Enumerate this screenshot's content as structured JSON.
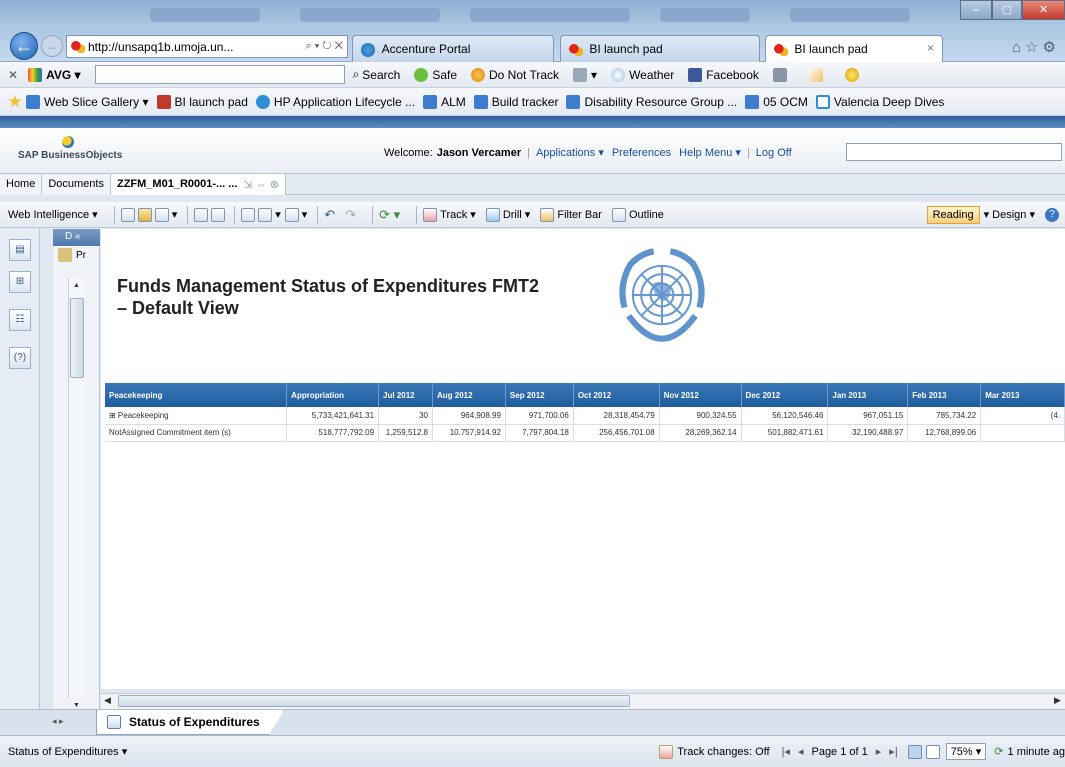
{
  "browser": {
    "address": "http://unsapq1b.umoja.un...",
    "address_controls": "⌕ ▾ ↻ ✕",
    "tabs": [
      "Accenture Portal",
      "BI launch pad",
      "BI launch pad"
    ],
    "tab_close": "×",
    "window_buttons": [
      "–",
      "▢",
      "✕"
    ]
  },
  "avg_toolbar": {
    "close": "✕",
    "brand": "AVG ▾",
    "search": "Search",
    "safe": "Safe",
    "do_not_track": "Do Not Track",
    "weather": "Weather",
    "facebook": "Facebook"
  },
  "favorites": [
    "Web Slice Gallery ▾",
    "BI launch pad",
    "HP Application Lifecycle ...",
    "ALM",
    "Build tracker",
    "Disability Resource Group ...",
    "05 OCM",
    "Valencia Deep Dives"
  ],
  "sap_header": {
    "logo": "SAP BusinessObjects",
    "welcome_label": "Welcome:",
    "user": "Jason Vercamer",
    "applications": "Applications ▾",
    "preferences": "Preferences",
    "help": "Help Menu ▾",
    "logoff": "Log Off"
  },
  "doc_tabs": {
    "home": "Home",
    "documents": "Documents",
    "current": "ZZFM_M01_R0001-... ..."
  },
  "wi_toolbar": {
    "web_intelligence": "Web Intelligence ▾",
    "track": "Track ▾",
    "drill": "Drill ▾",
    "filter_bar": "Filter Bar",
    "outline": "Outline",
    "reading": "Reading",
    "design": "▾ Design ▾",
    "help": "?"
  },
  "nav_panel": {
    "header": "D «",
    "item": "Pr"
  },
  "report": {
    "title_line1": "Funds Management Status of Expenditures FMT2",
    "title_line2": "– Default View",
    "columns": [
      "Peacekeeping",
      "Appropriation",
      "Jul 2012",
      "Aug 2012",
      "Sep 2012",
      "Oct 2012",
      "Nov 2012",
      "Dec 2012",
      "Jan 2013",
      "Feb 2013",
      "Mar 2013"
    ],
    "rows": [
      [
        "⊞ Peacekeeping",
        "5,733,421,641.31",
        "30",
        "964,908.99",
        "971,700.06",
        "28,318,454.79",
        "900,324.55",
        "56,120,546.46",
        "967,051.15",
        "785,734.22",
        "(4."
      ],
      [
        "NotAssigned Commitment item (s)",
        "518,777,792.09",
        "1,259,512.8",
        "10,757,914.92",
        "7,797,804.18",
        "256,456,701.08",
        "28,269,362.14",
        "501,882,471.61",
        "32,190,488.97",
        "12,768,899.06",
        ""
      ]
    ]
  },
  "report_tab": "Status of Expenditures",
  "status_bar": {
    "left": "Status of Expenditures ▾",
    "track_changes": "Track changes: Off",
    "page": "Page 1 of 1",
    "zoom": "75%",
    "refresh": "1 minute ag"
  }
}
